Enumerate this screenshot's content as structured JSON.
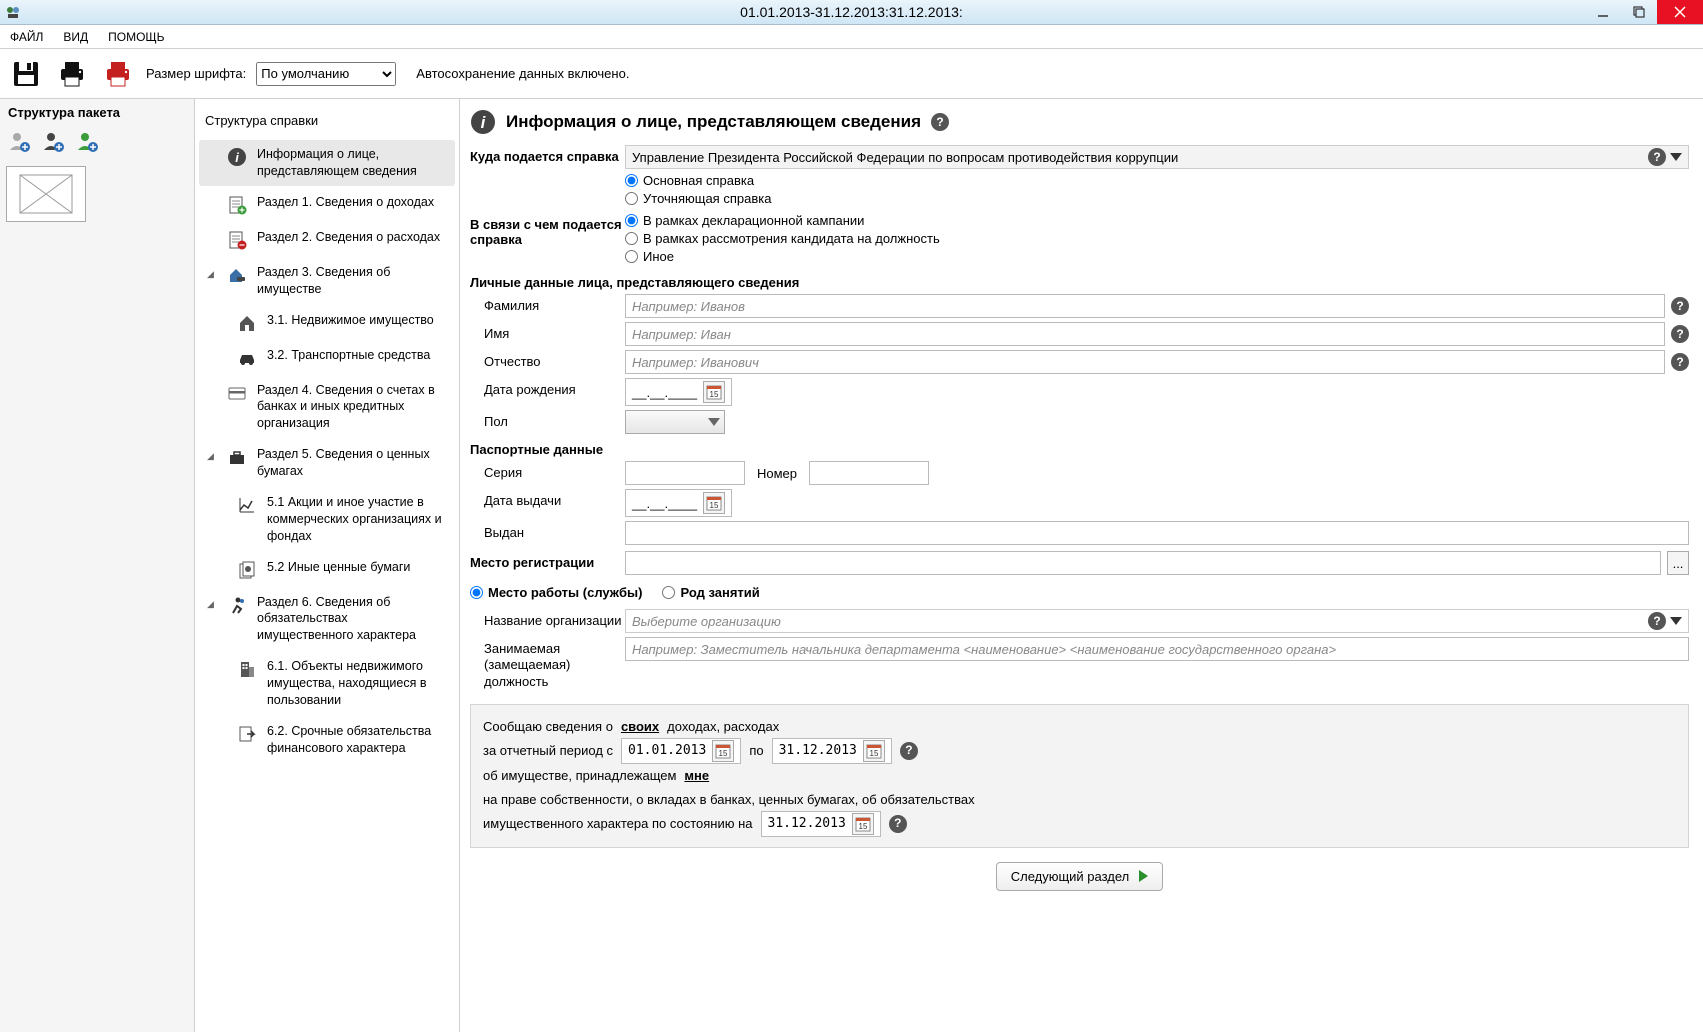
{
  "window": {
    "title": "01.01.2013-31.12.2013:31.12.2013:"
  },
  "menu": {
    "file": "ФАЙЛ",
    "view": "ВИД",
    "help": "ПОМОЩЬ"
  },
  "toolbar": {
    "font_label": "Размер шрифта:",
    "font_value": "По умолчанию",
    "autosave": "Автосохранение данных включено."
  },
  "left": {
    "header": "Структура пакета"
  },
  "mid": {
    "header": "Структура справки",
    "items": [
      {
        "label": "Информация о лице, представляющем сведения"
      },
      {
        "label": "Раздел 1. Сведения о доходах"
      },
      {
        "label": "Раздел 2. Сведения о расходах"
      },
      {
        "label": "Раздел 3. Сведения об имуществе"
      },
      {
        "label": "3.1. Недвижимое имущество"
      },
      {
        "label": "3.2. Транспортные средства"
      },
      {
        "label": "Раздел 4. Сведения о счетах в банках и иных кредитных организация"
      },
      {
        "label": "Раздел 5. Сведения о ценных бумагах"
      },
      {
        "label": "5.1 Акции и иное участие в коммерческих организациях и фондах"
      },
      {
        "label": "5.2 Иные ценные бумаги"
      },
      {
        "label": "Раздел 6. Сведения об обязательствах имущественного характера"
      },
      {
        "label": "6.1. Объекты недвижимого имущества, находящиеся в пользовании"
      },
      {
        "label": "6.2. Срочные обязательства финансового характера"
      }
    ]
  },
  "form": {
    "title": "Информация о лице, представляющем сведения",
    "dest_label": "Куда подается справка",
    "dest_value": "Управление Президента Российской Федерации по вопросам противодействия коррупции",
    "type_main": "Основная справка",
    "type_corr": "Уточняющая справка",
    "reason_label": "В связи с чем подается справка",
    "reason_1": "В рамках декларационной кампании",
    "reason_2": "В рамках рассмотрения кандидата на должность",
    "reason_3": "Иное",
    "personal_head": "Личные данные лица, представляющего сведения",
    "lastname_label": "Фамилия",
    "lastname_ph": "Например: Иванов",
    "firstname_label": "Имя",
    "firstname_ph": "Например: Иван",
    "patronym_label": "Отчество",
    "patronym_ph": "Например: Иванович",
    "dob_label": "Дата рождения",
    "date_mask": "__.__.____",
    "gender_label": "Пол",
    "passport_head": "Паспортные данные",
    "series_label": "Серия",
    "number_label": "Номер",
    "issue_date_label": "Дата выдачи",
    "issued_by_label": "Выдан",
    "reg_label": "Место регистрации",
    "work_label": "Место работы (службы)",
    "occupation_label": "Род занятий",
    "org_label": "Название организации",
    "org_ph": "Выберите организацию",
    "position_label": "Занимаемая (замещаемая) должность",
    "position_ph": "Например: Заместитель начальника департамента <наименование> <наименование государственного органа>"
  },
  "footer": {
    "line1_a": "Сообщаю сведения о ",
    "line1_b": "своих",
    "line1_c": " доходах, расходах",
    "line2_a": "за отчетный период с",
    "date_from": "01.01.2013",
    "line2_b": "по",
    "date_to": "31.12.2013",
    "line3_a": "об имуществе, принадлежащем ",
    "line3_b": "мне",
    "line4": "на праве собственности, о вкладах в банках, ценных бумагах, об обязательствах",
    "line5_a": "имущественного характера по состоянию на",
    "date_status": "31.12.2013"
  },
  "next_button": "Следующий раздел"
}
